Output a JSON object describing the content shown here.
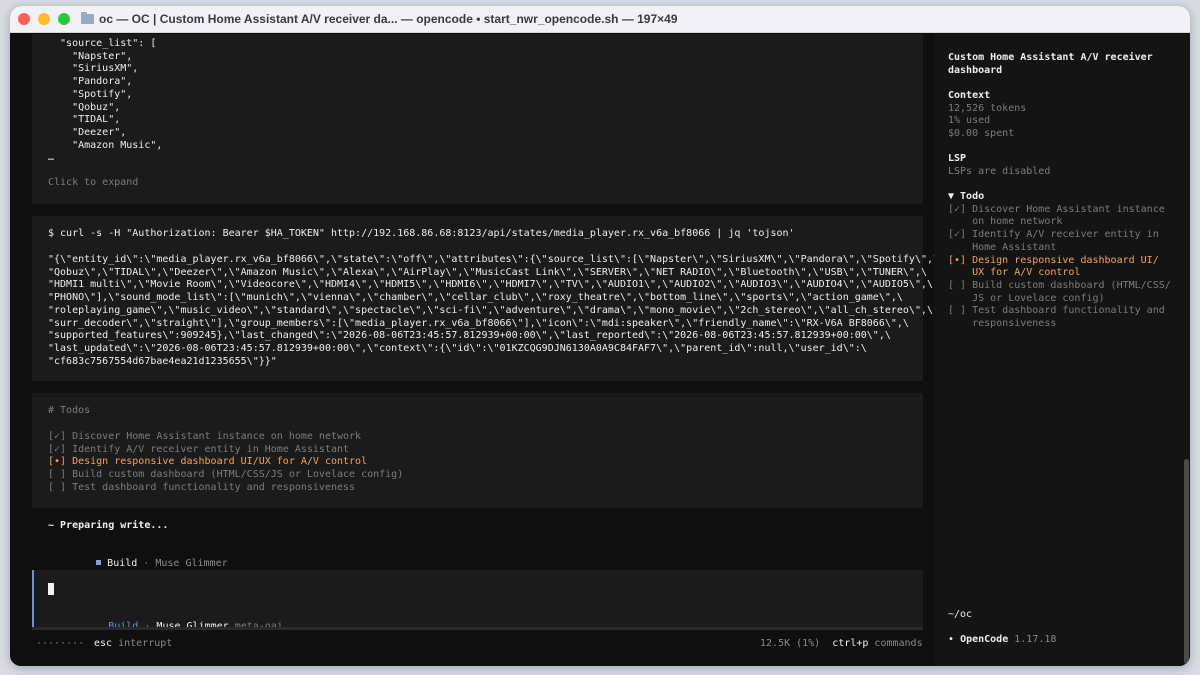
{
  "window": {
    "title": "oc — OC | Custom Home Assistant A/V receiver da... — opencode • start_nwr_opencode.sh — 197×49"
  },
  "output_block": {
    "lines": [
      "  \"source_list\": [",
      "    \"Napster\",",
      "    \"SiriusXM\",",
      "    \"Pandora\",",
      "    \"Spotify\",",
      "    \"Qobuz\",",
      "    \"TIDAL\",",
      "    \"Deezer\",",
      "    \"Amazon Music\",",
      "…"
    ],
    "expand_label": "Click to expand"
  },
  "command_block": {
    "command": "$ curl -s -H \"Authorization: Bearer $HA_TOKEN\" http://192.168.86.68:8123/api/states/media_player.rx_v6a_bf8066 | jq 'tojson'",
    "result_lines": [
      "\"{\\\"entity_id\\\":\\\"media_player.rx_v6a_bf8066\\\",\\\"state\\\":\\\"off\\\",\\\"attributes\\\":{\\\"source_list\\\":[\\\"Napster\\\",\\\"SiriusXM\\\",\\\"Pandora\\\",\\\"Spotify\\\",\\",
      "\"Qobuz\\\",\\\"TIDAL\\\",\\\"Deezer\\\",\\\"Amazon Music\\\",\\\"Alexa\\\",\\\"AirPlay\\\",\\\"MusicCast Link\\\",\\\"SERVER\\\",\\\"NET RADIO\\\",\\\"Bluetooth\\\",\\\"USB\\\",\\\"TUNER\\\",\\",
      "\"HDMI1 multi\\\",\\\"Movie Room\\\",\\\"Videocore\\\",\\\"HDMI4\\\",\\\"HDMI5\\\",\\\"HDMI6\\\",\\\"HDMI7\\\",\\\"TV\\\",\\\"AUDIO1\\\",\\\"AUDIO2\\\",\\\"AUDIO3\\\",\\\"AUDIO4\\\",\\\"AUDIO5\\\",\\",
      "\"PHONO\\\"],\\\"sound_mode_list\\\":[\\\"munich\\\",\\\"vienna\\\",\\\"chamber\\\",\\\"cellar_club\\\",\\\"roxy_theatre\\\",\\\"bottom_line\\\",\\\"sports\\\",\\\"action_game\\\",\\",
      "\"roleplaying_game\\\",\\\"music_video\\\",\\\"standard\\\",\\\"spectacle\\\",\\\"sci-fi\\\",\\\"adventure\\\",\\\"drama\\\",\\\"mono_movie\\\",\\\"2ch_stereo\\\",\\\"all_ch_stereo\\\",\\",
      "\"surr_decoder\\\",\\\"straight\\\"],\\\"group_members\\\":[\\\"media_player.rx_v6a_bf8066\\\"],\\\"icon\\\":\\\"mdi:speaker\\\",\\\"friendly_name\\\":\\\"RX-V6A BF8066\\\",\\",
      "\"supported_features\\\":909245},\\\"last_changed\\\":\\\"2026-08-06T23:45:57.812939+00:00\\\",\\\"last_reported\\\":\\\"2026-08-06T23:45:57.812939+00:00\\\",\\",
      "\"last_updated\\\":\\\"2026-08-06T23:45:57.812939+00:00\\\",\\\"context\\\":{\\\"id\\\":\\\"01KZCQG9DJN6130A0A9C84FAF7\\\",\\\"parent_id\\\":null,\\\"user_id\\\":\\",
      "\"cf683c7567554d67bae4ea21d1235655\\\"}}\""
    ]
  },
  "todos_block": {
    "heading": "# Todos",
    "items": [
      {
        "text": "[✓] Discover Home Assistant instance on home network",
        "state": "done"
      },
      {
        "text": "[✓] Identify A/V receiver entity in Home Assistant",
        "state": "done"
      },
      {
        "text": "[•] Design responsive dashboard UI/UX for A/V control",
        "state": "active"
      },
      {
        "text": "[ ] Build custom dashboard (HTML/CSS/JS or Lovelace config)",
        "state": "pending"
      },
      {
        "text": "[ ] Test dashboard functionality and responsiveness",
        "state": "pending"
      }
    ]
  },
  "status": {
    "preparing": "~ Preparing write...",
    "agent_mode": "Build",
    "agent_separator": "·",
    "agent_name": "Muse Glimmer"
  },
  "input": {
    "mode": "Build",
    "separator": "·",
    "agent": "Muse Glimmer",
    "provider": "meta-oai"
  },
  "footer": {
    "dots": "········",
    "esc_key": "esc",
    "esc_label": "interrupt",
    "usage": "12.5K (1%)",
    "shortcut_key": "ctrl+p",
    "shortcut_label": "commands"
  },
  "sidebar": {
    "title_lines": [
      "Custom Home Assistant A/V receiver",
      "dashboard"
    ],
    "context_heading": "Context",
    "tokens": "12,526 tokens",
    "used": "1% used",
    "spent": "$0.00 spent",
    "lsp_heading": "LSP",
    "lsp_status": "LSPs are disabled",
    "todo_heading": "▼ Todo",
    "todo_lines": [
      {
        "text": "[✓] Discover Home Assistant instance",
        "state": "done"
      },
      {
        "text": "    on home network",
        "state": "done"
      },
      {
        "text": "[✓] Identify A/V receiver entity in",
        "state": "done"
      },
      {
        "text": "    Home Assistant",
        "state": "done"
      },
      {
        "text": "[•] Design responsive dashboard UI/",
        "state": "active"
      },
      {
        "text": "    UX for A/V control",
        "state": "active"
      },
      {
        "text": "[ ] Build custom dashboard (HTML/CSS/",
        "state": "pending"
      },
      {
        "text": "    JS or Lovelace config)",
        "state": "pending"
      },
      {
        "text": "[ ] Test dashboard functionality and",
        "state": "pending"
      },
      {
        "text": "    responsiveness",
        "state": "pending"
      }
    ],
    "cwd": "~/oc",
    "app_bullet": "•",
    "app_name": "OpenCode",
    "app_version": "1.17.18"
  },
  "colors": {
    "accent_blue": "#6f8fd9",
    "active_orange": "#f0a35e",
    "background": "#0f0f0f",
    "panel": "#1b1b1b"
  }
}
